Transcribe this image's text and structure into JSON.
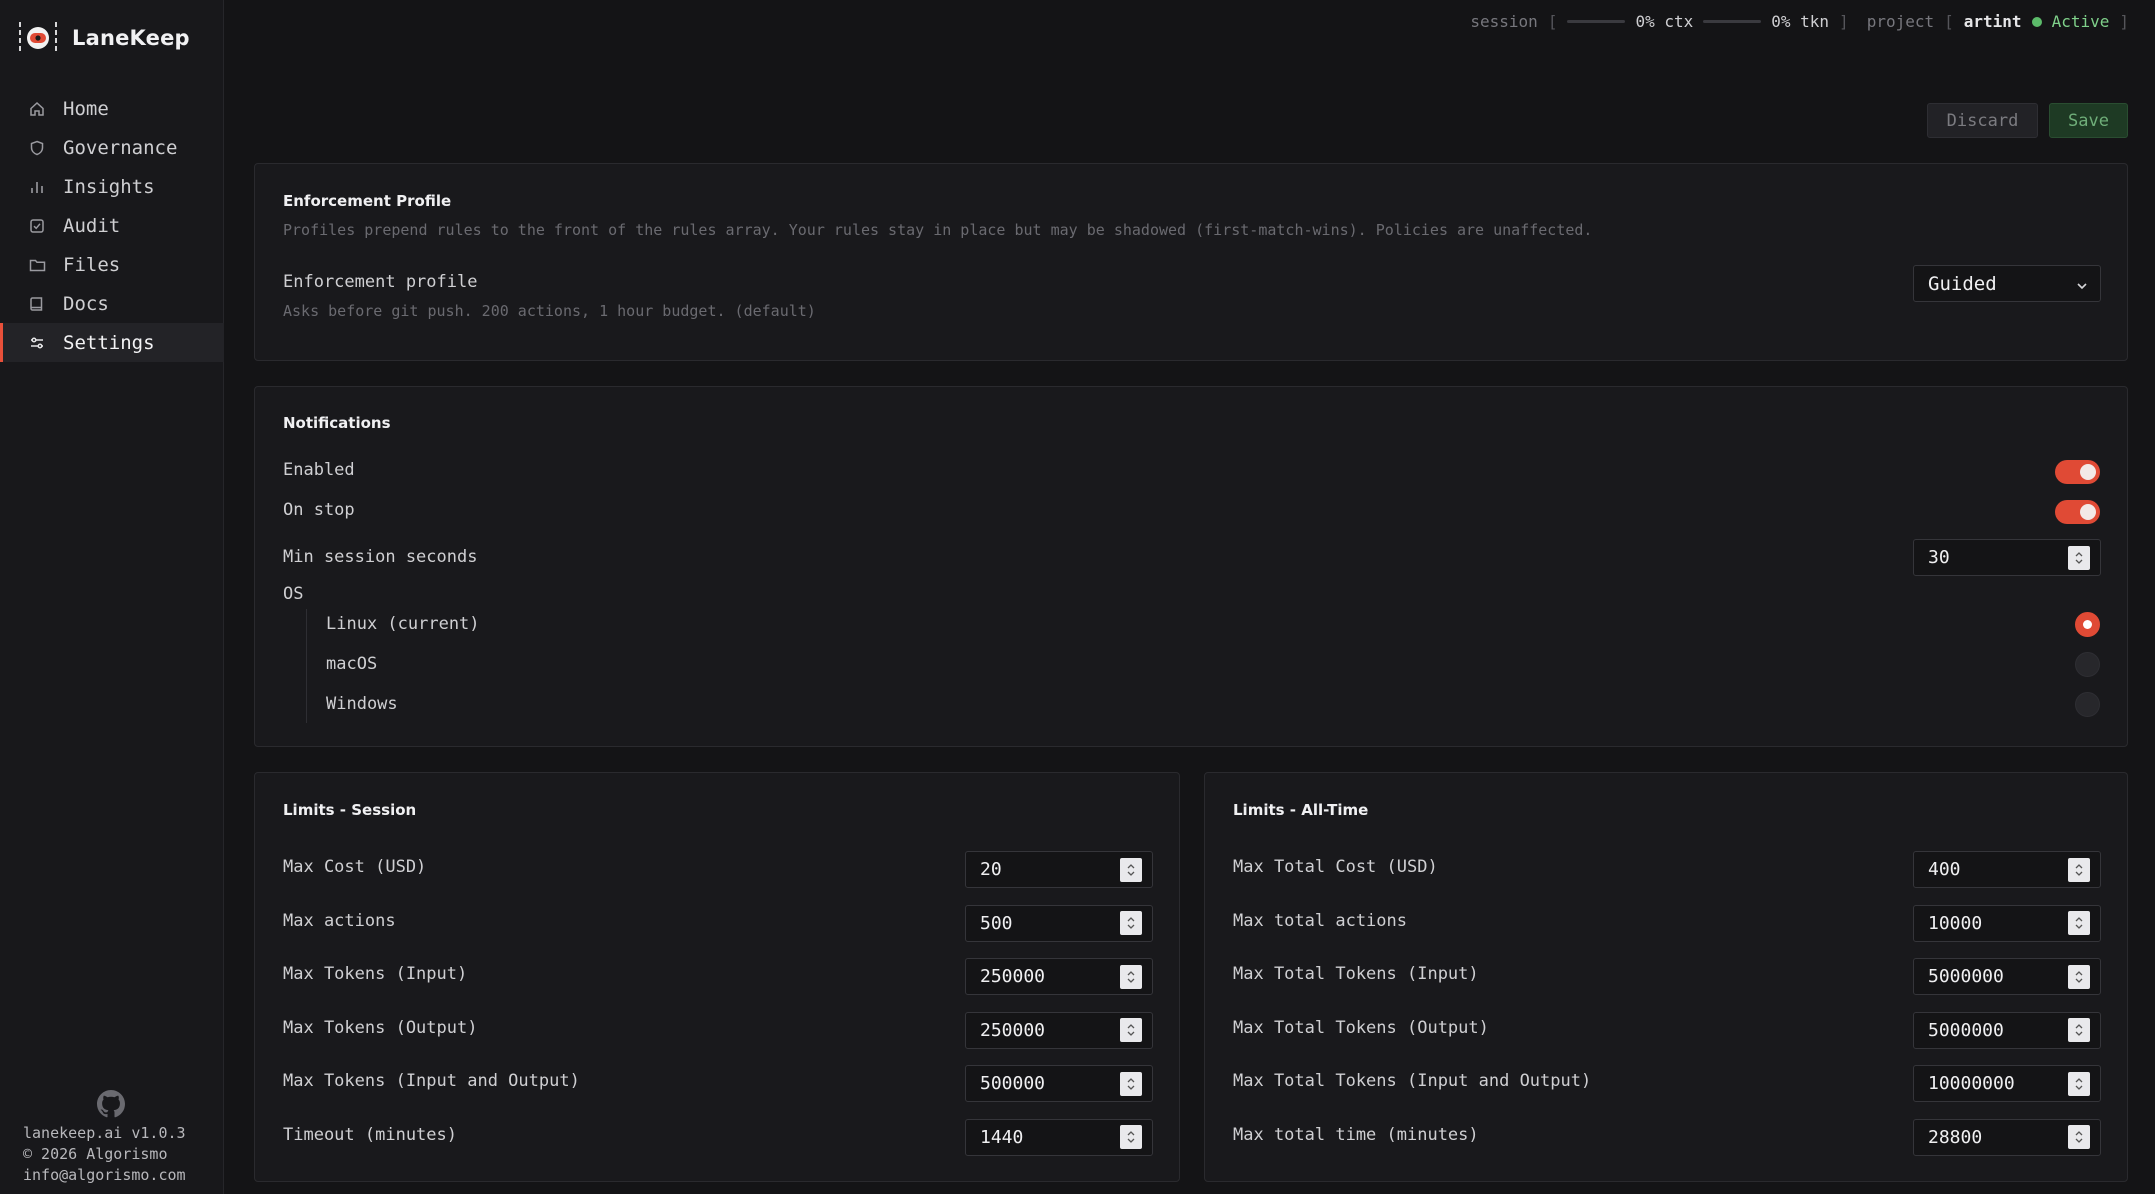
{
  "app": {
    "name": "LaneKeep"
  },
  "nav": [
    {
      "label": "Home",
      "icon": "home-icon"
    },
    {
      "label": "Governance",
      "icon": "shield-icon"
    },
    {
      "label": "Insights",
      "icon": "bar-chart-icon"
    },
    {
      "label": "Audit",
      "icon": "checkbox-icon"
    },
    {
      "label": "Files",
      "icon": "folder-icon"
    },
    {
      "label": "Docs",
      "icon": "book-icon"
    },
    {
      "label": "Settings",
      "icon": "sliders-icon",
      "active": true
    }
  ],
  "footer": {
    "site": "lanekeep.ai",
    "version": "v1.0.3",
    "copyright": "© 2026 Algorismo",
    "email": "info@algorismo.com"
  },
  "topbar": {
    "session_label": "session",
    "bracket_open": "[",
    "bracket_close": "]",
    "ctx": "0% ctx",
    "tkn": "0% tkn",
    "ctx_fraction": 0,
    "tkn_fraction": 0,
    "project_label": "project",
    "project_name": "artint",
    "status": "Active",
    "status_color": "#5cbb6a"
  },
  "actions": {
    "discard": "Discard",
    "save": "Save"
  },
  "enforcement": {
    "title": "Enforcement Profile",
    "description": "Profiles prepend rules to the front of the rules array. Your rules stay in place but may be shadowed (first-match-wins). Policies are unaffected.",
    "field_label": "Enforcement profile",
    "field_help": "Asks before git push. 200 actions, 1 hour budget. (default)",
    "selected": "Guided"
  },
  "notifications": {
    "title": "Notifications",
    "enabled_label": "Enabled",
    "enabled": true,
    "on_stop_label": "On stop",
    "on_stop": true,
    "min_session_label": "Min session seconds",
    "min_session_value": "30",
    "os_label": "OS",
    "os_options": [
      {
        "label": "Linux (current)",
        "selected": true
      },
      {
        "label": "macOS",
        "selected": false
      },
      {
        "label": "Windows",
        "selected": false
      }
    ]
  },
  "limits_session": {
    "title": "Limits - Session",
    "rows": [
      {
        "label": "Max Cost (USD)",
        "value": "20"
      },
      {
        "label": "Max actions",
        "value": "500"
      },
      {
        "label": "Max Tokens (Input)",
        "value": "250000"
      },
      {
        "label": "Max Tokens (Output)",
        "value": "250000"
      },
      {
        "label": "Max Tokens (Input and Output)",
        "value": "500000"
      },
      {
        "label": "Timeout (minutes)",
        "value": "1440"
      }
    ]
  },
  "limits_all_time": {
    "title": "Limits - All-Time",
    "rows": [
      {
        "label": "Max Total Cost (USD)",
        "value": "400"
      },
      {
        "label": "Max total actions",
        "value": "10000"
      },
      {
        "label": "Max Total Tokens (Input)",
        "value": "5000000"
      },
      {
        "label": "Max Total Tokens (Output)",
        "value": "5000000"
      },
      {
        "label": "Max Total Tokens (Input and Output)",
        "value": "10000000"
      },
      {
        "label": "Max total time (minutes)",
        "value": "28800"
      }
    ]
  },
  "colors": {
    "accent": "#e04a35",
    "save_green": "#6fae79"
  }
}
